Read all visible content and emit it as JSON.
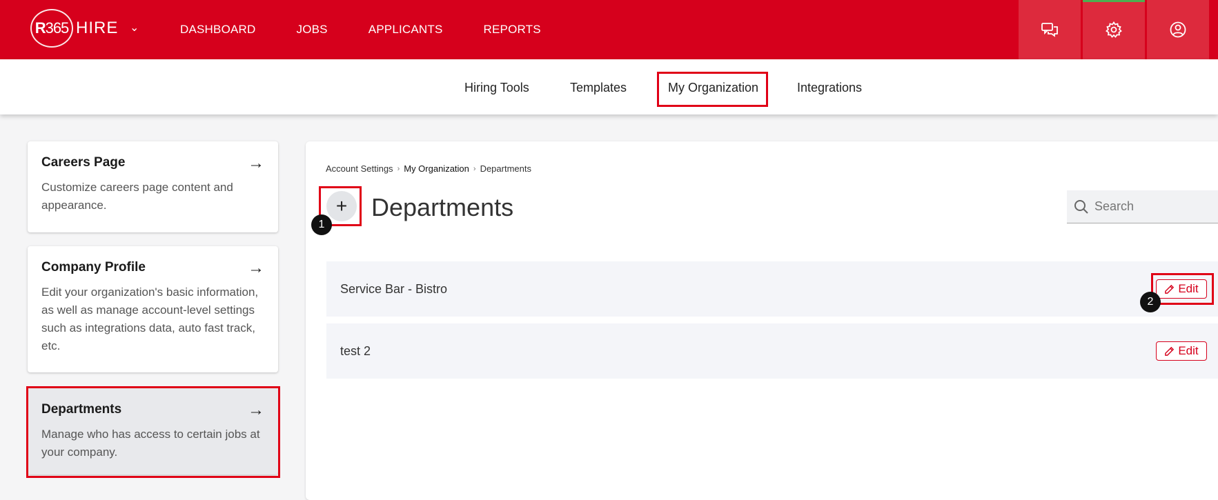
{
  "app": {
    "logo_mark_r": "R",
    "logo_mark_num": "365",
    "logo_word": "HIRE"
  },
  "topnav": [
    "DASHBOARD",
    "JOBS",
    "APPLICANTS",
    "REPORTS"
  ],
  "top_icons": [
    "chat-icon",
    "gear-icon",
    "user-icon"
  ],
  "subnav": [
    "Hiring Tools",
    "Templates",
    "My Organization",
    "Integrations"
  ],
  "sidebar": [
    {
      "title": "Careers Page",
      "desc": "Customize careers page content and appearance."
    },
    {
      "title": "Company Profile",
      "desc": "Edit your organization's basic information, as well as manage account-level settings such as integrations data, auto fast track, etc."
    },
    {
      "title": "Departments",
      "desc": "Manage who has access to certain jobs at your company."
    }
  ],
  "breadcrumb": [
    "Account Settings",
    "My Organization",
    "Departments"
  ],
  "main": {
    "title": "Departments",
    "add_label": "+",
    "search_placeholder": "Search"
  },
  "departments": [
    {
      "name": "Service Bar - Bistro",
      "edit_label": "Edit"
    },
    {
      "name": "test 2",
      "edit_label": "Edit"
    }
  ],
  "annotations": [
    "1",
    "2"
  ],
  "colors": {
    "brand": "#d6001c",
    "highlight": "#e00016",
    "active_tab": "#4caf50"
  }
}
